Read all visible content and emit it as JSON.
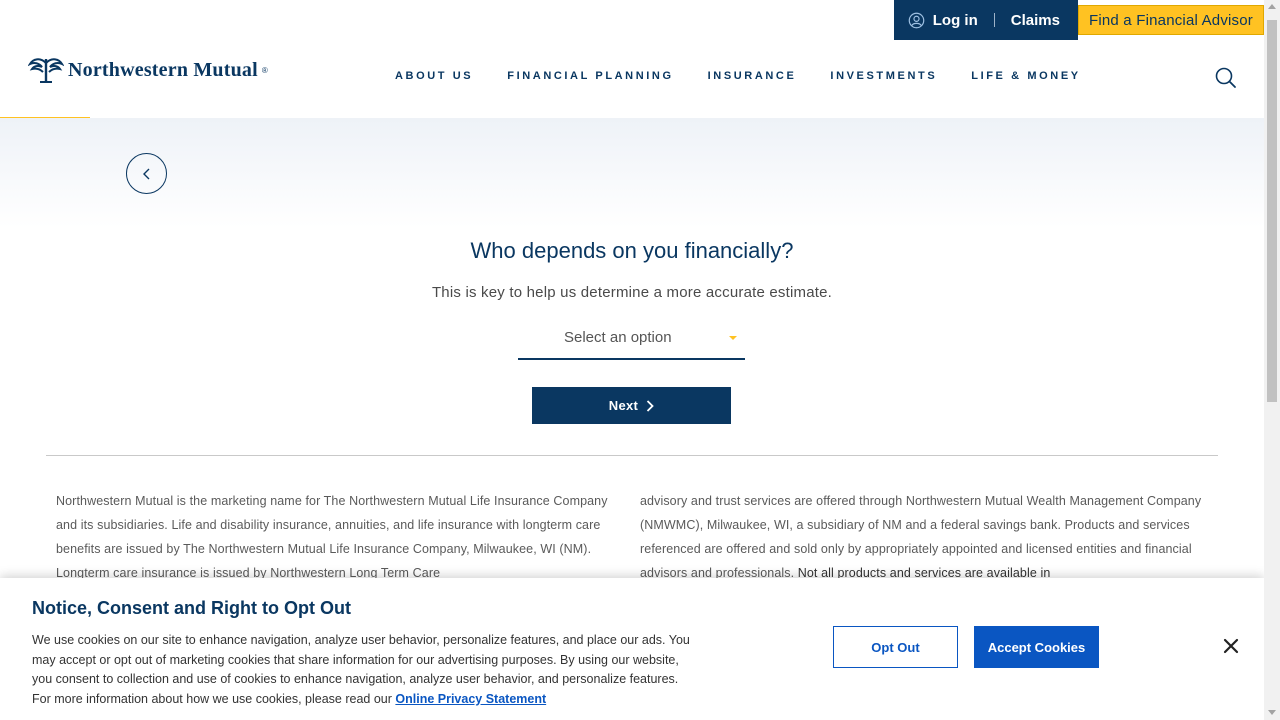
{
  "utility": {
    "login_label": "Log in",
    "claims_label": "Claims",
    "advisor_label": "Find a Financial Advisor"
  },
  "brand": {
    "name": "Northwestern Mutual",
    "reg": "®"
  },
  "nav": {
    "items": [
      {
        "label": "ABOUT US"
      },
      {
        "label": "FINANCIAL PLANNING"
      },
      {
        "label": "INSURANCE"
      },
      {
        "label": "INVESTMENTS"
      },
      {
        "label": "LIFE & MONEY"
      }
    ]
  },
  "form": {
    "question": "Who depends on you financially?",
    "subtext": "This is key to help us determine a more accurate estimate.",
    "select_placeholder": "Select an option",
    "next_label": "Next"
  },
  "disclaimer": {
    "left": "Northwestern Mutual is the marketing name for The Northwestern Mutual Life Insurance Company and its subsidiaries. Life and disability insurance, annuities, and life insurance with longterm care benefits are issued by The Northwestern Mutual Life Insurance Company, Milwaukee, WI (NM). Longterm care insurance is issued by Northwestern Long Term Care",
    "right": "advisory and trust services are offered through Northwestern Mutual Wealth Management Company (NMWMC), Milwaukee, WI, a subsidiary of NM and a federal savings bank. Products and services referenced are offered and sold only by appropriately appointed and licensed entities and financial advisors and professionals.",
    "right_strong": " Not all products and services are available in"
  },
  "cookie": {
    "title": "Notice, Consent and Right to Opt Out",
    "body": "We use cookies on our site to enhance navigation, analyze user behavior, personalize features, and place our ads. You may accept or opt out of marketing cookies that share information for our advertising purposes. By using our website, you consent to collection and use of cookies to enhance navigation, analyze user behavior, and personalize features. For more information about how we use cookies, please read our ",
    "link_label": "Online Privacy Statement",
    "opt_out_label": "Opt Out",
    "accept_label": "Accept Cookies"
  },
  "colors": {
    "navy": "#0a3761",
    "gold": "#ffc222",
    "link_blue": "#0a56c2"
  },
  "icons": {
    "user": "user-circle-icon",
    "search": "search-icon",
    "back": "chevron-left-icon",
    "next": "chevron-right-icon",
    "close": "close-icon",
    "caret": "caret-down-icon"
  }
}
